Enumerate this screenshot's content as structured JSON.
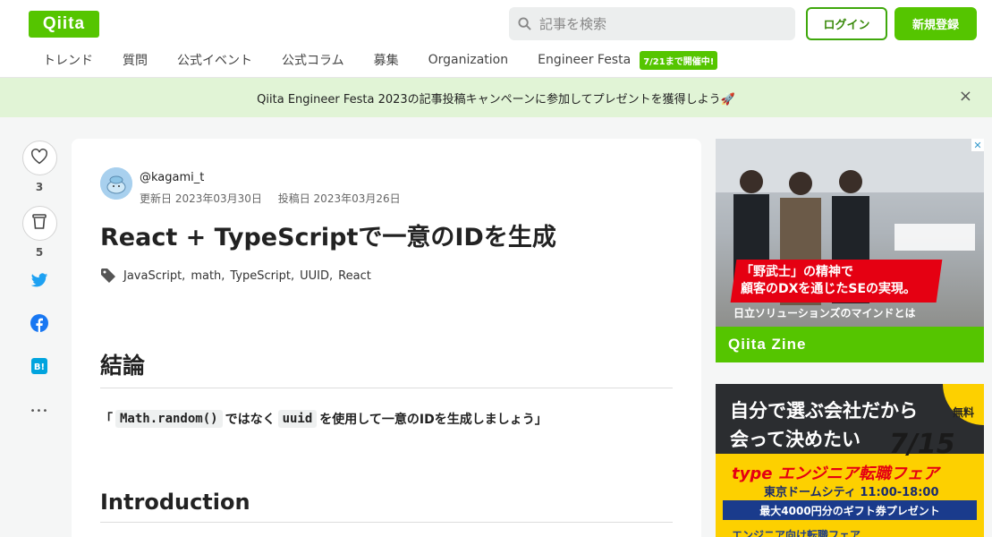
{
  "header": {
    "logo": "Qiita",
    "search_placeholder": "記事を検索",
    "login_label": "ログイン",
    "signup_label": "新規登録"
  },
  "nav": {
    "items": [
      "トレンド",
      "質問",
      "公式イベント",
      "公式コラム",
      "募集",
      "Organization",
      "Engineer Festa"
    ],
    "badge": "7/21まで開催中!"
  },
  "banner": {
    "text": "Qiita Engineer Festa 2023の記事投稿キャンペーンに参加してプレゼントを獲得しよう🚀",
    "close": "×"
  },
  "side": {
    "like_count": "3",
    "stock_count": "5",
    "more": "•••"
  },
  "article": {
    "author": "@kagami_t",
    "updated": "更新日 2023年03月30日",
    "posted": "投稿日 2023年03月26日",
    "title": "React + TypeScriptで一意のIDを生成",
    "tags": [
      "JavaScript",
      "math",
      "TypeScript",
      "UUID",
      "React"
    ],
    "tag_separator": ",",
    "heading_conclusion": "結論",
    "conclusion": {
      "open": "「",
      "code1": "Math.random()",
      "middle": "ではなく",
      "code2": "uuid",
      "rest": "を使用して一意のIDを生成しましょう」"
    },
    "heading_intro": "Introduction"
  },
  "ads": {
    "ad1": {
      "line1": "「野武士」の精神で",
      "line2": "顧客のDXを通じたSEの実現。",
      "sub": "日立ソリューションズのマインドとは",
      "brand": "Qiita Zine",
      "close": "✕"
    },
    "ad2": {
      "line1": "自分で選ぶ会社だから",
      "line2": "会って決めたい",
      "date": "7/15",
      "free": "無料",
      "brand": "type エンジニア転職フェア",
      "venue": "東京ドームシティ 11:00-18:00",
      "gift": "最大4000円分のギフト券プレゼント",
      "bottom": "エンジニア向け転職フェア"
    }
  },
  "colors": {
    "brand": "#55c500",
    "banner_bg": "#e1f4d6",
    "twitter": "#1da1f2",
    "facebook": "#1877f2",
    "hatena": "#00a4de"
  }
}
